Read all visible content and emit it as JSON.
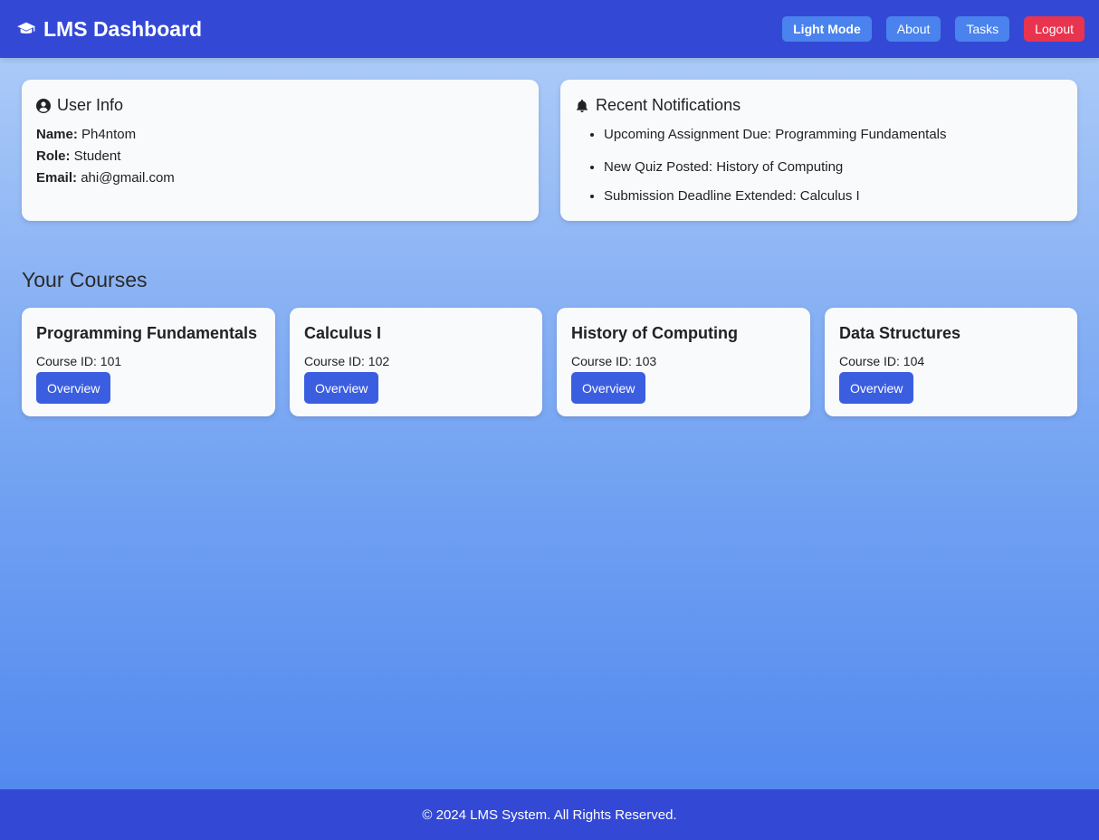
{
  "header": {
    "title": "LMS Dashboard",
    "brand_icon": "graduation-cap-icon",
    "buttons": {
      "light_mode": "Light Mode",
      "about": "About",
      "tasks": "Tasks",
      "logout": "Logout"
    }
  },
  "user_info": {
    "title": "User Info",
    "icon": "user-circle-icon",
    "name_label": "Name:",
    "name": "Ph4ntom",
    "role_label": "Role:",
    "role": "Student",
    "email_label": "Email:",
    "email": "ahi@gmail.com"
  },
  "notifications": {
    "title": "Recent Notifications",
    "icon": "bell-icon",
    "items": [
      "Upcoming Assignment Due: Programming Fundamentals",
      "New Quiz Posted: History of Computing",
      "Submission Deadline Extended: Calculus I"
    ]
  },
  "courses": {
    "title": "Your Courses",
    "button_label": "Overview",
    "items": [
      {
        "name": "Programming Fundamentals",
        "id_text": "Course ID: 101"
      },
      {
        "name": "Calculus I",
        "id_text": "Course ID: 102"
      },
      {
        "name": "History of Computing",
        "id_text": "Course ID: 103"
      },
      {
        "name": "Data Structures",
        "id_text": "Course ID: 104"
      }
    ]
  },
  "footer": {
    "text": "© 2024 LMS System. All Rights Reserved."
  },
  "colors": {
    "navbar": "#3349d5",
    "nav_button": "#4a82ee",
    "logout_button": "#e8344f",
    "overview_button": "#3b5ee0"
  }
}
